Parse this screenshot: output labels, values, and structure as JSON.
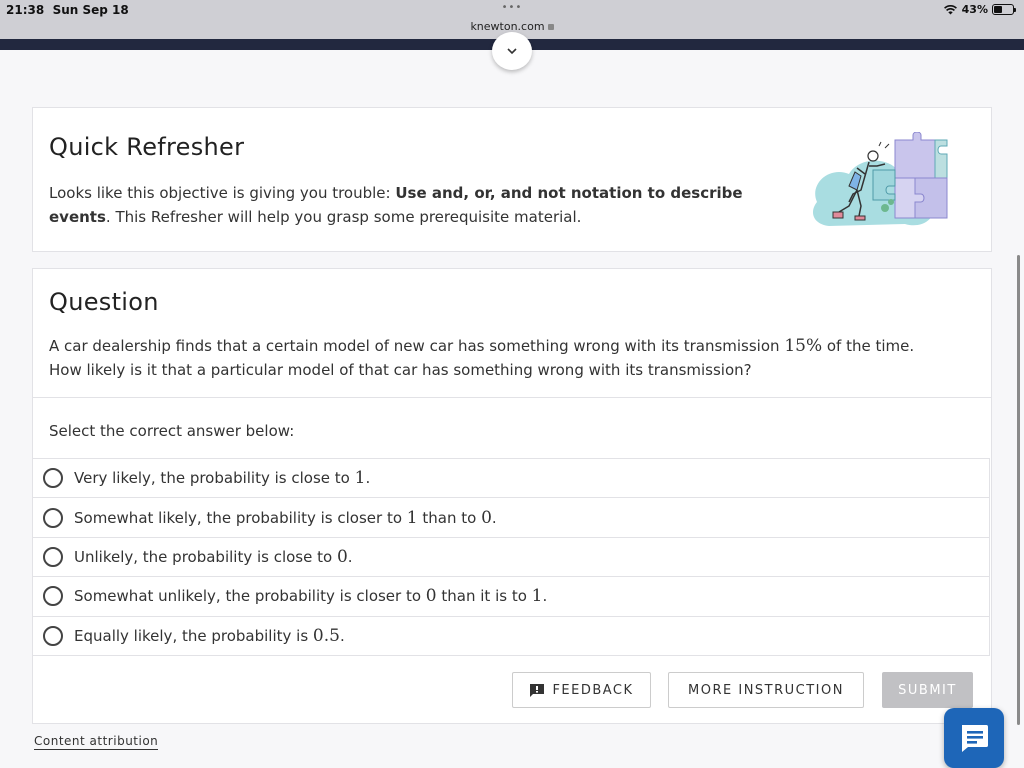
{
  "status_bar": {
    "time": "21:38",
    "date": "Sun Sep 18",
    "url": "knewton.com",
    "battery": "43%",
    "battery_level": 0.43
  },
  "refresher": {
    "title": "Quick Refresher",
    "intro": "Looks like this objective is giving you trouble: ",
    "objective": "Use and, or, and not notation to describe events",
    "outro": ". This Refresher will help you grasp some prerequisite material."
  },
  "question": {
    "title": "Question",
    "text_before": "A car dealership finds that a certain model of new car has something wrong with its transmission ",
    "percent": "15%",
    "text_after": " of the time. How likely is it that a particular model of that car has something wrong with its transmission?",
    "select_label": "Select the correct answer below:",
    "options": [
      {
        "parts": [
          "Very likely, the probability is close to ",
          "1",
          "."
        ]
      },
      {
        "parts": [
          "Somewhat likely, the probability is closer to ",
          "1",
          " than to ",
          "0",
          "."
        ]
      },
      {
        "parts": [
          "Unlikely, the probability is close to ",
          "0",
          "."
        ]
      },
      {
        "parts": [
          "Somewhat unlikely, the probability is closer to ",
          "0",
          " than it is to ",
          "1",
          "."
        ]
      },
      {
        "parts": [
          "Equally likely, the probability is ",
          "0.5",
          "."
        ]
      }
    ]
  },
  "buttons": {
    "feedback": "FEEDBACK",
    "more_instruction": "MORE INSTRUCTION",
    "submit": "SUBMIT"
  },
  "footer": {
    "attribution": "Content attribution"
  },
  "colors": {
    "navbar": "#22283f",
    "chat": "#1e66b8",
    "submit_disabled": "#c1c1c4"
  },
  "icons": {
    "feedback": "feedback-icon",
    "chat": "chat-icon",
    "collapse": "chevron-down-icon",
    "wifi": "wifi-icon",
    "battery": "battery-icon",
    "lock": "lock-icon"
  }
}
